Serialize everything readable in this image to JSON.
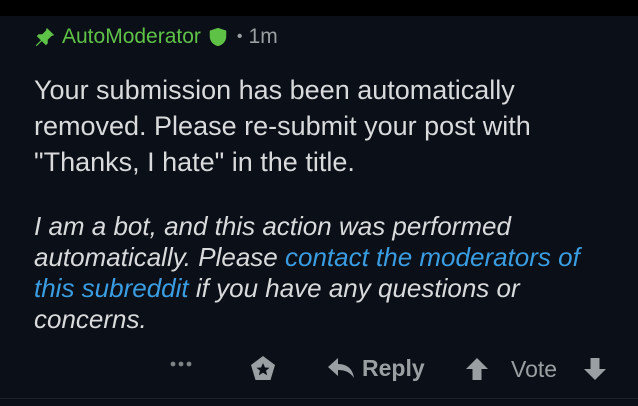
{
  "comment": {
    "author": "AutoModerator",
    "separator": "•",
    "time": "1m",
    "body": "Your submission has been automatically removed. Please re-submit your post with \"Thanks, I hate\" in the title.",
    "bot_note_prefix": "I am a bot, and this action was performed automatically. Please ",
    "bot_note_link": "contact the moderators of this subreddit",
    "bot_note_suffix": " if you have any questions or concerns."
  },
  "actions": {
    "reply_label": "Reply",
    "vote_label": "Vote"
  },
  "icons": {
    "pin": "pin-icon",
    "moderator": "shield-icon",
    "more": "more-icon",
    "award": "award-icon",
    "reply": "reply-icon",
    "upvote": "upvote-icon",
    "downvote": "downvote-icon"
  },
  "colors": {
    "background": "#0b0f17",
    "author": "#5ec247",
    "link": "#3a9de2",
    "muted": "#9a9fa3",
    "text": "#d8dadc"
  }
}
